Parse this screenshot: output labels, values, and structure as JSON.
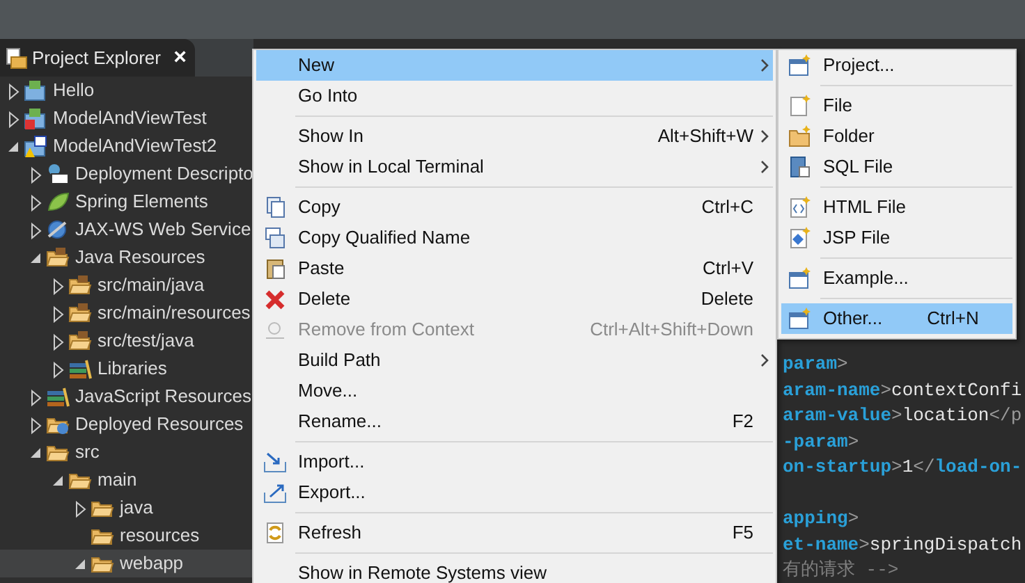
{
  "explorer": {
    "title": "Project Explorer",
    "close": "×"
  },
  "tree": [
    {
      "label": "Hello",
      "kind": "project",
      "expanded": false,
      "selected": false
    },
    {
      "label": "ModelAndViewTest",
      "kind": "project-error",
      "expanded": false,
      "selected": false
    },
    {
      "label": "ModelAndViewTest2",
      "kind": "project-warning",
      "expanded": true,
      "selected": false,
      "children": [
        {
          "label": "Deployment Descripto",
          "kind": "descriptor",
          "expanded": false,
          "selected": false
        },
        {
          "label": "Spring Elements",
          "kind": "spring",
          "expanded": false,
          "selected": false
        },
        {
          "label": "JAX-WS Web Service",
          "kind": "webservice",
          "expanded": false,
          "selected": false
        },
        {
          "label": "Java Resources",
          "kind": "package-folder",
          "expanded": true,
          "selected": false,
          "children": [
            {
              "label": "src/main/java",
              "kind": "package-folder",
              "expanded": false,
              "selected": false
            },
            {
              "label": "src/main/resources",
              "kind": "package-folder",
              "expanded": false,
              "selected": false
            },
            {
              "label": "src/test/java",
              "kind": "package-folder",
              "expanded": false,
              "selected": false
            },
            {
              "label": "Libraries",
              "kind": "library",
              "expanded": false,
              "selected": false
            }
          ]
        },
        {
          "label": "JavaScript Resources",
          "kind": "library",
          "expanded": false,
          "selected": false
        },
        {
          "label": "Deployed Resources",
          "kind": "deployed",
          "expanded": false,
          "selected": false
        },
        {
          "label": "src",
          "kind": "folder",
          "expanded": true,
          "selected": false,
          "children": [
            {
              "label": "main",
              "kind": "folder",
              "expanded": true,
              "selected": false,
              "children": [
                {
                  "label": "java",
                  "kind": "folder",
                  "expanded": false,
                  "selected": false
                },
                {
                  "label": "resources",
                  "kind": "folder",
                  "selected": false
                },
                {
                  "label": "webapp",
                  "kind": "folder",
                  "expanded": true,
                  "selected": true
                }
              ]
            }
          ]
        }
      ]
    }
  ],
  "code_lines": [
    {
      "kind": "code",
      "segments": [
        {
          "kind": "tag",
          "text": "param"
        },
        {
          "kind": "punct",
          "text": ">"
        }
      ]
    },
    {
      "kind": "code",
      "segments": [
        {
          "kind": "tag",
          "text": "aram-name"
        },
        {
          "kind": "punct",
          "text": ">"
        },
        {
          "kind": "text",
          "text": "contextConfi"
        }
      ]
    },
    {
      "kind": "code",
      "segments": [
        {
          "kind": "tag",
          "text": "aram-value"
        },
        {
          "kind": "punct",
          "text": ">"
        },
        {
          "kind": "text",
          "text": "location"
        },
        {
          "kind": "punct",
          "text": "</p"
        }
      ]
    },
    {
      "kind": "code",
      "segments": [
        {
          "kind": "tag",
          "text": "-param"
        },
        {
          "kind": "punct",
          "text": ">"
        }
      ]
    },
    {
      "kind": "code",
      "segments": [
        {
          "kind": "tag",
          "text": "on-startup"
        },
        {
          "kind": "punct",
          "text": ">"
        },
        {
          "kind": "text",
          "text": "1"
        },
        {
          "kind": "punct",
          "text": "</"
        },
        {
          "kind": "tag",
          "text": "load-on-"
        }
      ]
    },
    {
      "kind": "blank"
    },
    {
      "kind": "code",
      "segments": [
        {
          "kind": "tag",
          "text": "apping"
        },
        {
          "kind": "punct",
          "text": ">"
        }
      ]
    },
    {
      "kind": "code",
      "segments": [
        {
          "kind": "tag",
          "text": "et-name"
        },
        {
          "kind": "punct",
          "text": ">"
        },
        {
          "kind": "text",
          "text": "springDispatch"
        }
      ]
    },
    {
      "kind": "code",
      "segments": [
        {
          "kind": "comment",
          "text": "有的请求 -->"
        }
      ]
    }
  ],
  "context_menu": [
    {
      "kind": "plain",
      "label": "New",
      "submenu": true,
      "disabled": false,
      "selected": true
    },
    {
      "kind": "plain",
      "label": "Go Into",
      "submenu": false,
      "disabled": false,
      "selected": false
    },
    {
      "kind": "separator"
    },
    {
      "kind": "plain",
      "label": "Show In",
      "shortcut": "Alt+Shift+W",
      "submenu": true,
      "disabled": false,
      "selected": false
    },
    {
      "kind": "plain",
      "label": "Show in Local Terminal",
      "submenu": true,
      "disabled": false,
      "selected": false
    },
    {
      "kind": "separator"
    },
    {
      "kind": "copy",
      "label": "Copy",
      "shortcut": "Ctrl+C",
      "submenu": false,
      "disabled": false,
      "selected": false
    },
    {
      "kind": "copy-name",
      "label": "Copy Qualified Name",
      "submenu": false,
      "disabled": false,
      "selected": false
    },
    {
      "kind": "paste",
      "label": "Paste",
      "shortcut": "Ctrl+V",
      "submenu": false,
      "disabled": false,
      "selected": false
    },
    {
      "kind": "delete",
      "label": "Delete",
      "shortcut": "Delete",
      "submenu": false,
      "disabled": false,
      "selected": false
    },
    {
      "kind": "remove",
      "label": "Remove from Context",
      "shortcut": "Ctrl+Alt+Shift+Down",
      "submenu": false,
      "disabled": true,
      "selected": false
    },
    {
      "kind": "plain",
      "label": "Build Path",
      "submenu": true,
      "disabled": false,
      "selected": false
    },
    {
      "kind": "plain",
      "label": "Move...",
      "submenu": false,
      "disabled": false,
      "selected": false
    },
    {
      "kind": "plain",
      "label": "Rename...",
      "shortcut": "F2",
      "submenu": false,
      "disabled": false,
      "selected": false
    },
    {
      "kind": "separator"
    },
    {
      "kind": "import",
      "label": "Import...",
      "submenu": false,
      "disabled": false,
      "selected": false
    },
    {
      "kind": "export",
      "label": "Export...",
      "submenu": false,
      "disabled": false,
      "selected": false
    },
    {
      "kind": "separator"
    },
    {
      "kind": "refresh",
      "label": "Refresh",
      "shortcut": "F5",
      "submenu": false,
      "disabled": false,
      "selected": false
    },
    {
      "kind": "separator"
    },
    {
      "kind": "plain",
      "label": "Show in Remote Systems view",
      "submenu": false,
      "disabled": false,
      "selected": false
    }
  ],
  "new_submenu": [
    {
      "kind": "window-new",
      "label": "Project...",
      "selected": false
    },
    {
      "kind": "separator"
    },
    {
      "kind": "file-new",
      "label": "File",
      "selected": false
    },
    {
      "kind": "folder-new",
      "label": "Folder",
      "selected": false
    },
    {
      "kind": "sql",
      "label": "SQL File",
      "selected": false
    },
    {
      "kind": "separator"
    },
    {
      "kind": "html",
      "label": "HTML File",
      "selected": false
    },
    {
      "kind": "jsp",
      "label": "JSP File",
      "selected": false
    },
    {
      "kind": "separator"
    },
    {
      "kind": "window-new",
      "label": "Example...",
      "selected": false
    },
    {
      "kind": "separator"
    },
    {
      "kind": "window-new",
      "label": "Other...",
      "shortcut": "Ctrl+N",
      "selected": true
    }
  ]
}
